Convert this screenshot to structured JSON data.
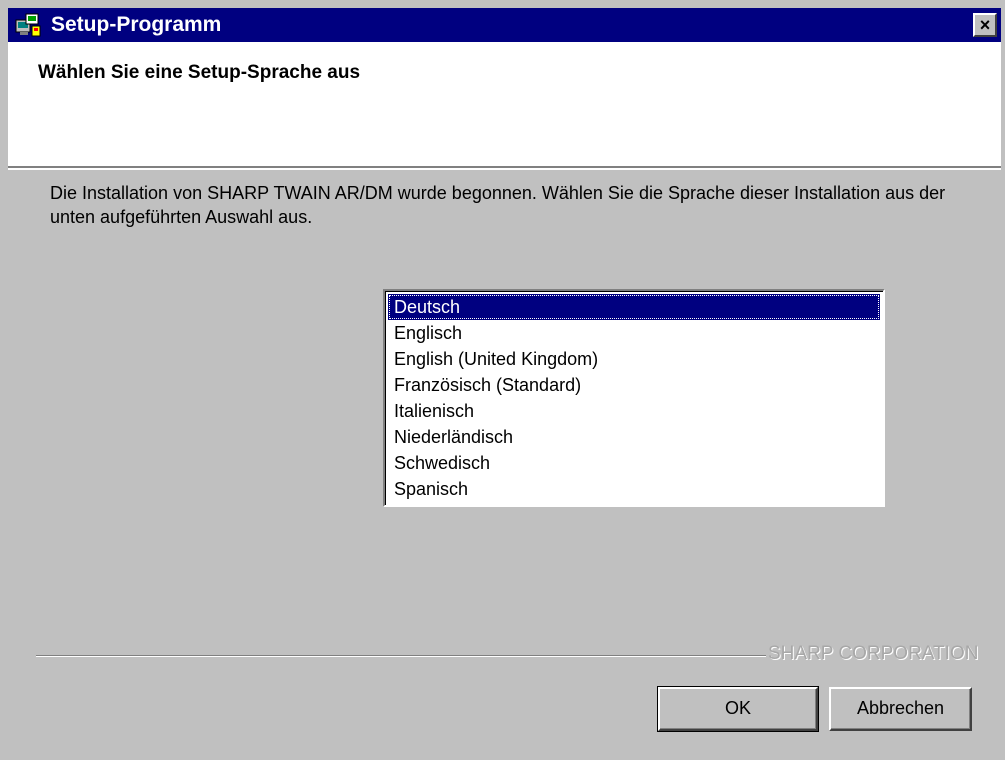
{
  "window": {
    "title": "Setup-Programm",
    "close_label": "×"
  },
  "header": {
    "title": "Wählen Sie eine Setup-Sprache aus"
  },
  "description": "Die Installation von SHARP TWAIN AR/DM wurde begonnen.  Wählen Sie die Sprache dieser Installation aus der unten aufgeführten Auswahl aus.",
  "languages": {
    "selected": "Deutsch",
    "items": [
      {
        "label": "Deutsch"
      },
      {
        "label": "Englisch"
      },
      {
        "label": "English (United Kingdom)"
      },
      {
        "label": "Französisch (Standard)"
      },
      {
        "label": "Italienisch"
      },
      {
        "label": "Niederländisch"
      },
      {
        "label": "Schwedisch"
      },
      {
        "label": "Spanisch"
      }
    ]
  },
  "footer": {
    "company": "SHARP CORPORATION"
  },
  "buttons": {
    "ok_label": "OK",
    "cancel_label": "Abbrechen"
  },
  "colors": {
    "title_bar": "#000080",
    "face": "#c0c0c0",
    "selection": "#000080"
  }
}
